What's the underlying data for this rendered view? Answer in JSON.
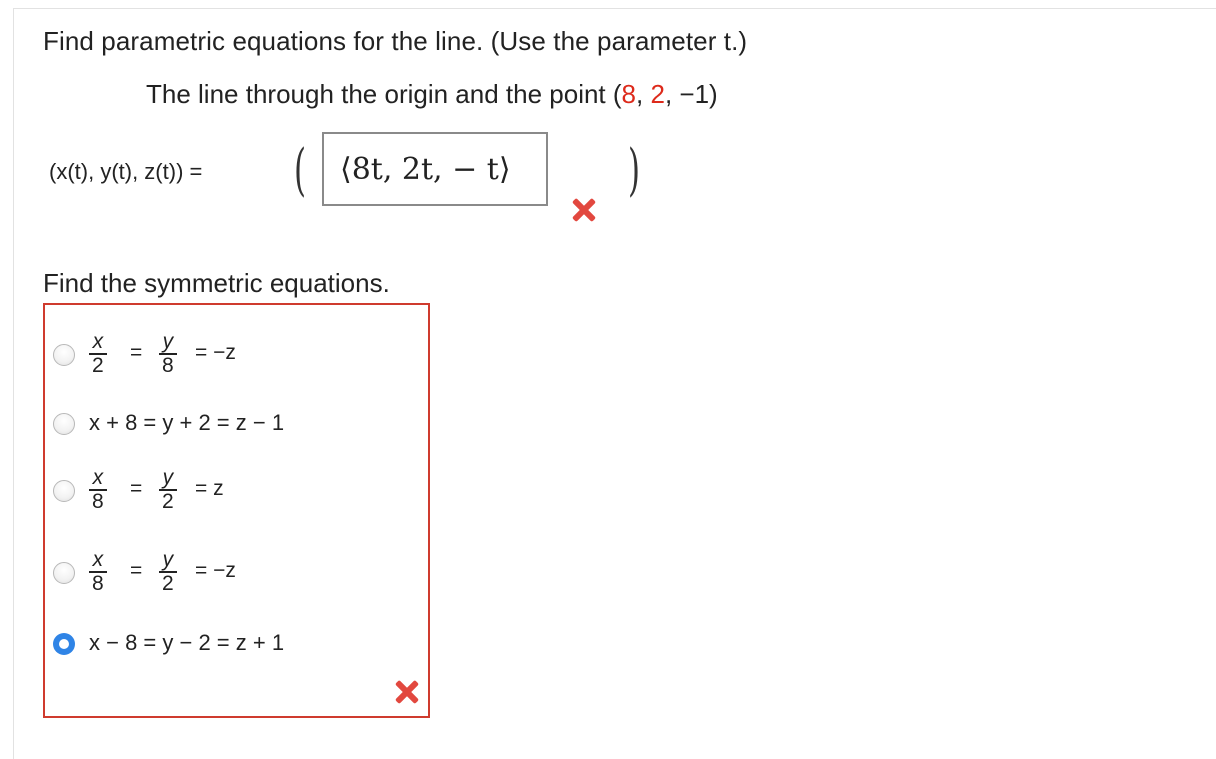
{
  "question": {
    "instruction": "Find parametric equations for the line. (Use the parameter t.)",
    "line_description_prefix": "The line through the origin and the point (",
    "point": {
      "x": "8",
      "y": "2",
      "z": "−1"
    },
    "line_description_suffix": ")"
  },
  "parametric": {
    "label": "(x(t), y(t), z(t)) =",
    "answer_value": "⟨8t, 2t, − t⟩",
    "status": "incorrect"
  },
  "symmetric": {
    "title": "Find the symmetric equations.",
    "options": [
      {
        "id": "opt1",
        "type": "fraction",
        "num1": "x",
        "den1": "2",
        "num2": "y",
        "den2": "8",
        "rhs": "= −z",
        "selected": false
      },
      {
        "id": "opt2",
        "type": "text",
        "text": "x + 8 = y + 2 = z − 1",
        "selected": false
      },
      {
        "id": "opt3",
        "type": "fraction",
        "num1": "x",
        "den1": "8",
        "num2": "y",
        "den2": "2",
        "rhs": "= z",
        "selected": false
      },
      {
        "id": "opt4",
        "type": "fraction",
        "num1": "x",
        "den1": "8",
        "num2": "y",
        "den2": "2",
        "rhs": "= −z",
        "selected": false
      },
      {
        "id": "opt5",
        "type": "text",
        "text": "x − 8 = y − 2 = z + 1",
        "selected": true
      }
    ],
    "status": "incorrect"
  },
  "colors": {
    "incorrect": "#e2483f",
    "radio_selected": "#2f84e6",
    "point_highlight": "#dd2a1b"
  },
  "icons": {
    "status": "x-mark-icon"
  }
}
